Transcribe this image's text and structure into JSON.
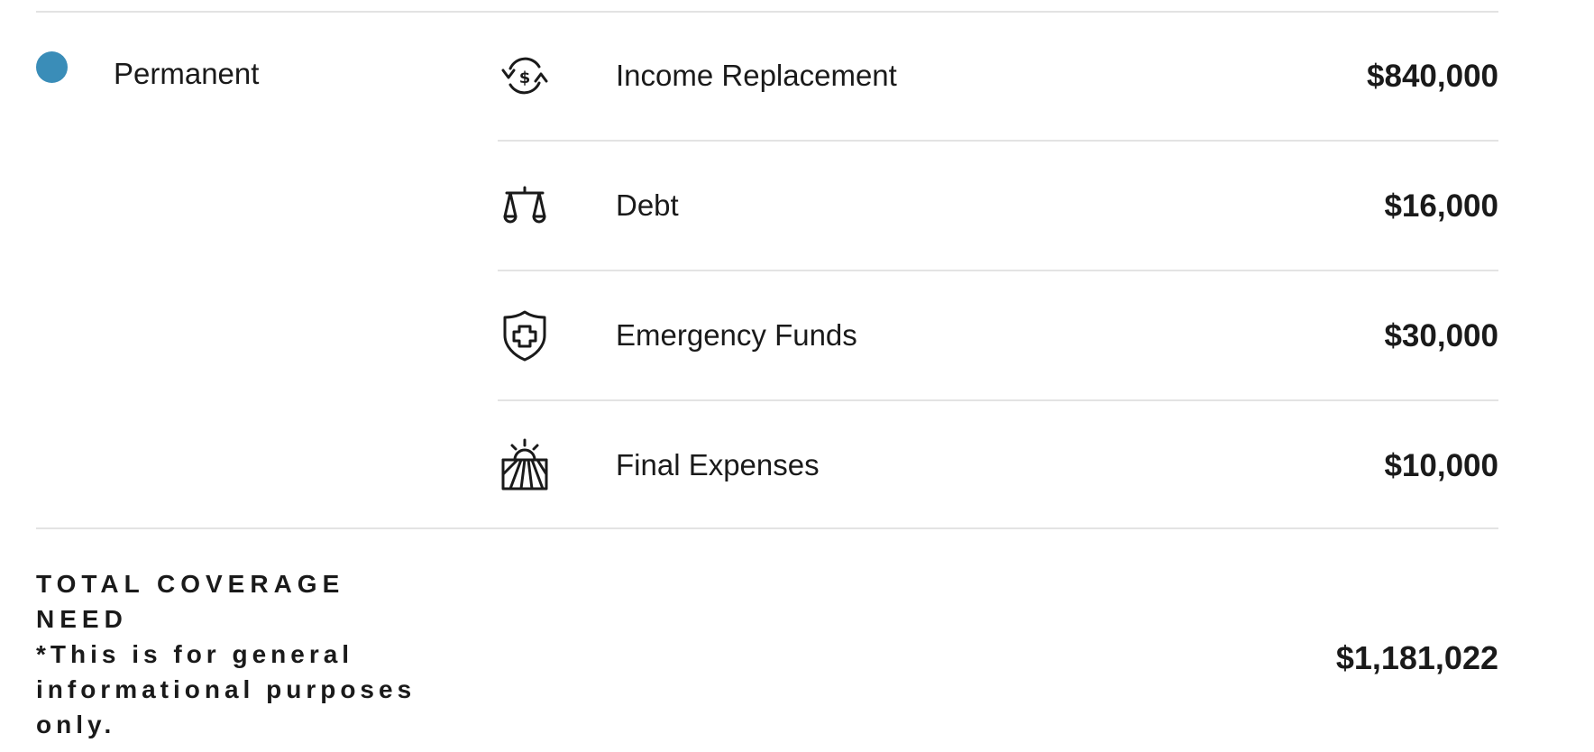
{
  "category": {
    "label": "Permanent",
    "dot_color": "#3a8db8"
  },
  "rows": [
    {
      "icon": "income-replacement-icon",
      "label": "Income Replacement",
      "value": "$840,000"
    },
    {
      "icon": "scales-icon",
      "label": "Debt",
      "value": "$16,000"
    },
    {
      "icon": "shield-plus-icon",
      "label": "Emergency Funds",
      "value": "$30,000"
    },
    {
      "icon": "sunset-field-icon",
      "label": "Final Expenses",
      "value": "$10,000"
    }
  ],
  "total": {
    "title": "TOTAL COVERAGE NEED",
    "note": "*This is for general informational purposes only.",
    "value": "$1,181,022"
  }
}
